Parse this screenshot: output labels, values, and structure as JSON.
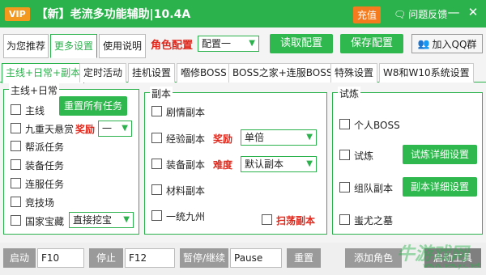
{
  "titlebar": {
    "vip": "VIP",
    "title": "【新】老流多功能辅助|10.4A",
    "recharge": "充值",
    "feedback": "问题反馈",
    "minimize": "—",
    "close": "✕"
  },
  "toolbar": {
    "tab_recommend": "为您推荐",
    "tab_more": "更多设置",
    "tab_help": "使用说明",
    "role_label": "角色配置",
    "config_select": "配置一",
    "read_config": "读取配置",
    "save_config": "保存配置",
    "qq_group": "加入QQ群"
  },
  "tabs": [
    "主线+日常+副本",
    "定时活动",
    "挂机设置",
    "嗰修BOSS",
    "BOSS之家+连服BOSS",
    "特殊设置",
    "W8和W10系统设置"
  ],
  "group_main": {
    "title": "主线+日常",
    "mainline": "主线",
    "reset_all": "重置所有任务",
    "nine_heavens": "九重天悬赏",
    "reward_label": "奖励",
    "reward_select": "一",
    "guild": "帮派任务",
    "equip": "装备任务",
    "cross_server": "连服任务",
    "arena": "竞技场",
    "national_treasure": "国家宝藏",
    "treasure_select": "直接挖宝"
  },
  "group_dungeon": {
    "title": "副本",
    "story": "剧情副本",
    "exp": "经验副本",
    "exp_reward_label": "奖励",
    "exp_reward_select": "单倍",
    "equip": "装备副本",
    "difficulty_label": "难度",
    "difficulty_select": "默认副本",
    "material": "材料副本",
    "unify": "一统九州",
    "sweep": "扫荡副本"
  },
  "group_trial": {
    "title": "试炼",
    "personal_boss": "个人BOSS",
    "trial": "试炼",
    "trial_detail": "试炼详细设置",
    "team_dungeon": "组队副本",
    "dungeon_detail": "副本详细设置",
    "chiyou": "蚩尤之墓"
  },
  "bottom": {
    "start": "启动",
    "start_key": "F10",
    "stop": "停止",
    "stop_key": "F12",
    "pause": "暂停/继续",
    "pause_key": "Pause",
    "reset": "重置",
    "add_role": "添加角色",
    "launch_tool": "启动工具",
    "watermark": "牛游戏网",
    "watermark_url": "www.newyx.net"
  },
  "colors": {
    "accent": "#2bb24c",
    "red": "#e0281c",
    "orange": "#f39a1e"
  }
}
